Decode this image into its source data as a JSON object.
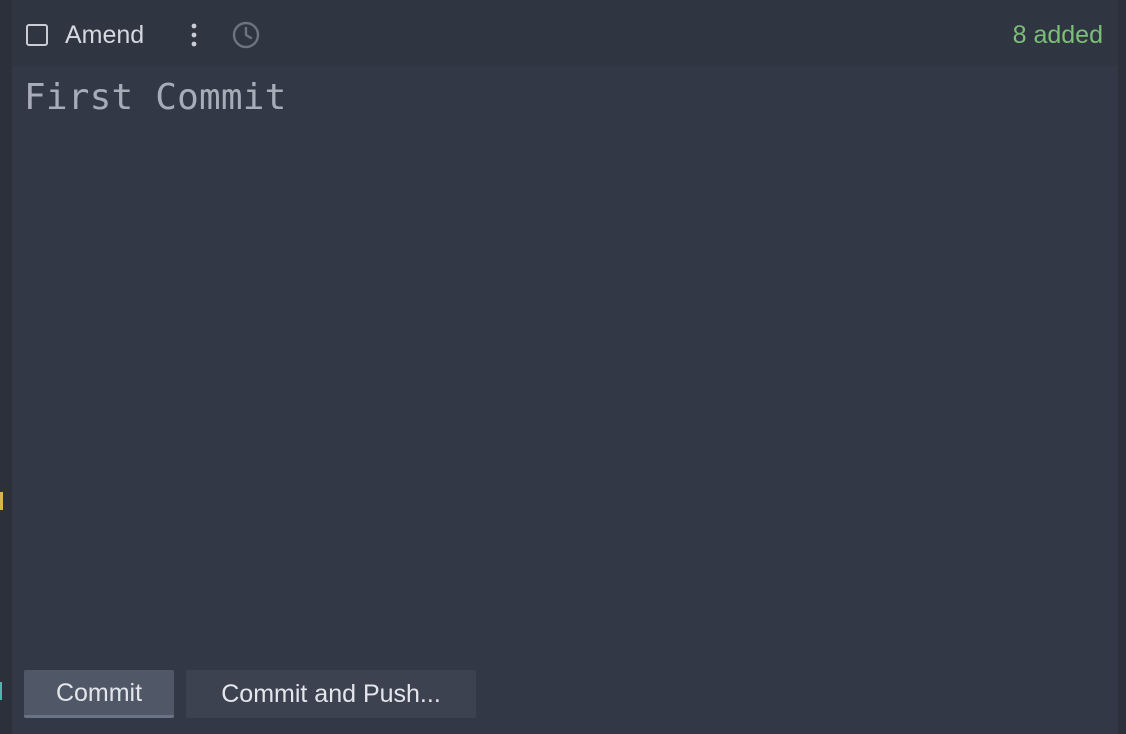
{
  "toolbar": {
    "amend_label": "Amend",
    "amend_checked": false,
    "more_icon": "more-vertical-icon",
    "history_icon": "clock-icon",
    "added_status": "8 added",
    "status_color": "#7cbf76"
  },
  "editor": {
    "message": "First Commit"
  },
  "actions": {
    "commit_label": "Commit",
    "commit_push_label": "Commit and Push..."
  }
}
